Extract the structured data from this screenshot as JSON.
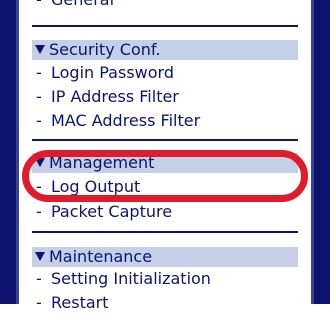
{
  "sidebar": {
    "sections": [
      {
        "items": [
          {
            "label": "General"
          }
        ]
      },
      {
        "title": "Security Conf.",
        "items": [
          {
            "label": "Login Password"
          },
          {
            "label": "IP Address Filter"
          },
          {
            "label": "MAC Address Filter"
          }
        ]
      },
      {
        "title": "Management",
        "items": [
          {
            "label": "Log Output"
          },
          {
            "label": "Packet Capture"
          }
        ]
      },
      {
        "title": "Maintenance",
        "items": [
          {
            "label": "Setting Initialization"
          },
          {
            "label": "Restart"
          }
        ]
      }
    ]
  },
  "colors": {
    "frame": "#0d1470",
    "header_bg": "#c3d0e7",
    "text": "#0d1470",
    "highlight": "#e01b2b"
  },
  "icons": {
    "section_expanded": "triangle-down-icon",
    "item_bullet": "dash-icon"
  }
}
